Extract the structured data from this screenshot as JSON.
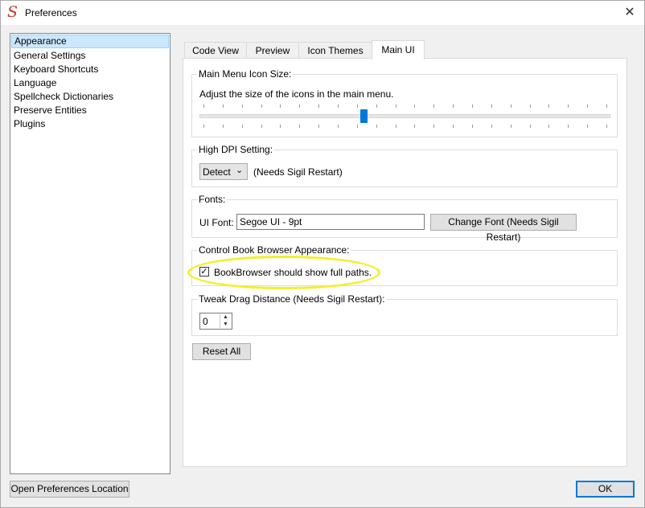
{
  "window": {
    "title": "Preferences",
    "close_glyph": "✕",
    "app_icon_glyph": "S"
  },
  "sidebar": {
    "items": [
      {
        "label": "Appearance",
        "selected": true
      },
      {
        "label": "General Settings"
      },
      {
        "label": "Keyboard Shortcuts"
      },
      {
        "label": "Language"
      },
      {
        "label": "Spellcheck Dictionaries"
      },
      {
        "label": "Preserve Entities"
      },
      {
        "label": "Plugins"
      }
    ]
  },
  "tabs": [
    {
      "label": "Code View"
    },
    {
      "label": "Preview"
    },
    {
      "label": "Icon Themes"
    },
    {
      "label": "Main UI",
      "active": true
    }
  ],
  "main_menu_icon_size": {
    "title": "Main Menu Icon Size:",
    "description": "Adjust the size of the icons in the main menu.",
    "slider_value_fraction": 0.4
  },
  "high_dpi": {
    "title": "High DPI Setting:",
    "combo_value": "Detect",
    "note": "(Needs Sigil Restart)"
  },
  "fonts": {
    "title": "Fonts:",
    "ui_font_label": "UI Font:",
    "ui_font_value": "Segoe UI - 9pt",
    "change_button": "Change Font (Needs Sigil Restart)"
  },
  "book_browser": {
    "title": "Control Book Browser Appearance:",
    "checkbox_label": "BookBrowser should show full paths.",
    "checked": true,
    "check_glyph": "✓"
  },
  "tweak_drag": {
    "title": "Tweak Drag Distance (Needs Sigil Restart):",
    "value": "0"
  },
  "reset_button": "Reset All",
  "open_location_button": "Open Preferences Location",
  "ok_button": "OK",
  "colors": {
    "accent": "#0078d7",
    "highlight_annotation": "#f4ef2a"
  }
}
